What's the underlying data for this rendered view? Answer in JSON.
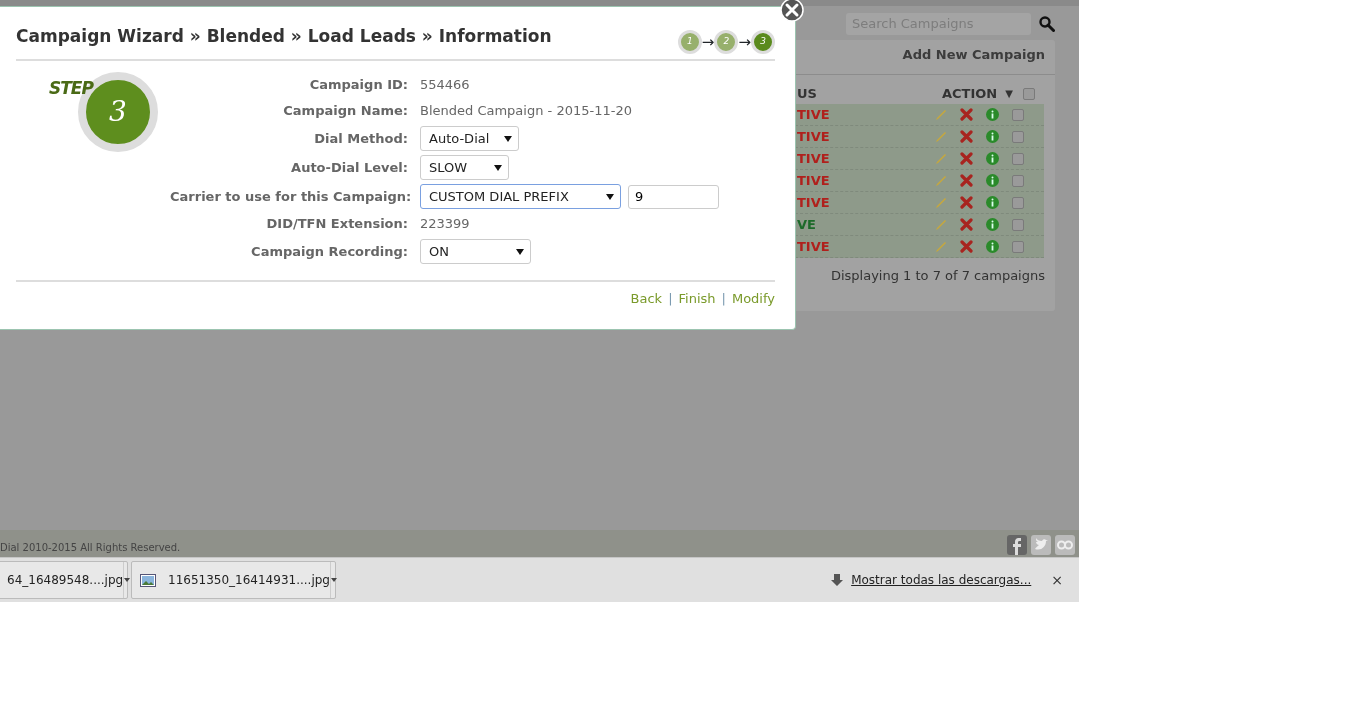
{
  "background": {
    "search": {
      "placeholder": "Search Campaigns"
    },
    "panel": {
      "add_link": "Add New Campaign",
      "columns": [
        "US",
        "ACTION",
        "▼"
      ],
      "header_checked": false,
      "rows": [
        {
          "status": "TIVE",
          "active": false,
          "checked": false
        },
        {
          "status": "TIVE",
          "active": false,
          "checked": false
        },
        {
          "status": "TIVE",
          "active": false,
          "checked": false
        },
        {
          "status": "TIVE",
          "active": false,
          "checked": false
        },
        {
          "status": "TIVE",
          "active": false,
          "checked": false
        },
        {
          "status": "VE",
          "active": true,
          "checked": false
        },
        {
          "status": "TIVE",
          "active": false,
          "checked": false
        }
      ],
      "summary": "Displaying 1 to 7 of 7 campaigns"
    }
  },
  "modal": {
    "title": "Campaign Wizard » Blended » Load Leads » Information",
    "steps": [
      {
        "label": "1",
        "selected": false
      },
      {
        "arrow": "→",
        "label": "2",
        "selected": false
      },
      {
        "arrow": "→",
        "label": "3",
        "selected": true
      }
    ],
    "step_badge": {
      "word": "STEP",
      "number": "3"
    },
    "fields": [
      {
        "kind": "text",
        "label": "Campaign ID:",
        "value": "554466"
      },
      {
        "kind": "text",
        "label": "Campaign Name:",
        "value": "Blended Campaign - 2015-11-20"
      },
      {
        "kind": "select",
        "label": "Dial Method:",
        "value": "Auto-Dial"
      },
      {
        "kind": "select",
        "label": "Auto-Dial Level:",
        "value": "SLOW"
      },
      {
        "kind": "select_input",
        "label": "Carrier to use for this Campaign:",
        "value": "CUSTOM DIAL PREFIX",
        "input": "9",
        "focused": true
      },
      {
        "kind": "text",
        "label": "DID/TFN Extension:",
        "value": "223399"
      },
      {
        "kind": "select",
        "label": "Campaign Recording:",
        "value": "ON"
      }
    ],
    "links": [
      {
        "label": "Back"
      },
      {
        "separator": "|",
        "label": "Finish"
      },
      {
        "separator": "|",
        "label": "Modify"
      }
    ]
  },
  "footer": {
    "copyright": "Dial 2010-2015 All Rights Reserved."
  },
  "downloads": {
    "items": [
      {
        "name": "64_16489548....jpg",
        "icon": false
      },
      {
        "name": "11651350_16414931....jpg",
        "icon": true
      }
    ],
    "show_all": "Mostrar todas las descargas...",
    "close": "×"
  }
}
